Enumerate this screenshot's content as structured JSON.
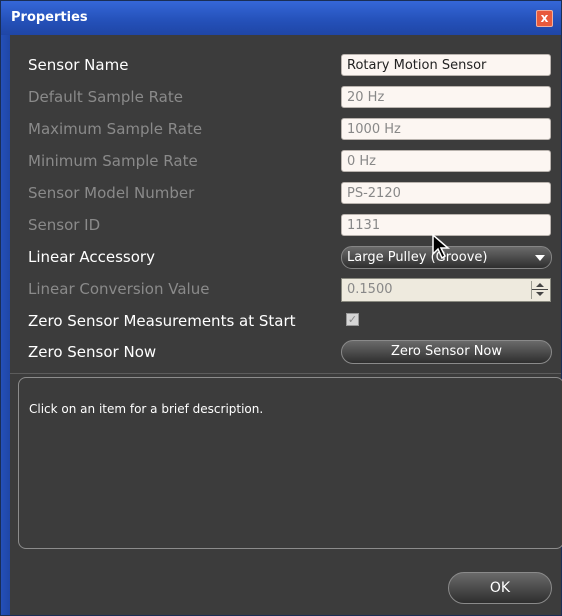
{
  "window": {
    "title": "Properties",
    "close_glyph": "x"
  },
  "properties": [
    {
      "label": "Sensor Name",
      "value": "Rotary Motion Sensor",
      "enabled": true
    },
    {
      "label": "Default Sample Rate",
      "value": "20 Hz",
      "enabled": false
    },
    {
      "label": "Maximum Sample Rate",
      "value": "1000 Hz",
      "enabled": false
    },
    {
      "label": "Minimum Sample Rate",
      "value": "0 Hz",
      "enabled": false
    },
    {
      "label": "Sensor Model Number",
      "value": "PS-2120",
      "enabled": false
    },
    {
      "label": "Sensor ID",
      "value": "1131",
      "enabled": false
    }
  ],
  "linear_accessory": {
    "label": "Linear Accessory",
    "selected": "Large Pulley (Groove)"
  },
  "linear_conversion": {
    "label": "Linear Conversion Value",
    "value": "0.1500"
  },
  "zero_at_start": {
    "label": "Zero Sensor Measurements at Start",
    "checked": true,
    "check_glyph": "✓"
  },
  "zero_now": {
    "label": "Zero Sensor Now",
    "button_label": "Zero Sensor Now"
  },
  "description": {
    "text": "Click on an item for a brief description."
  },
  "footer": {
    "ok_label": "OK"
  },
  "colors": {
    "titlebar": "#2450b8",
    "panel": "#3c3c3c",
    "field_bg": "#fcf6f2",
    "close": "#e85a3c"
  }
}
